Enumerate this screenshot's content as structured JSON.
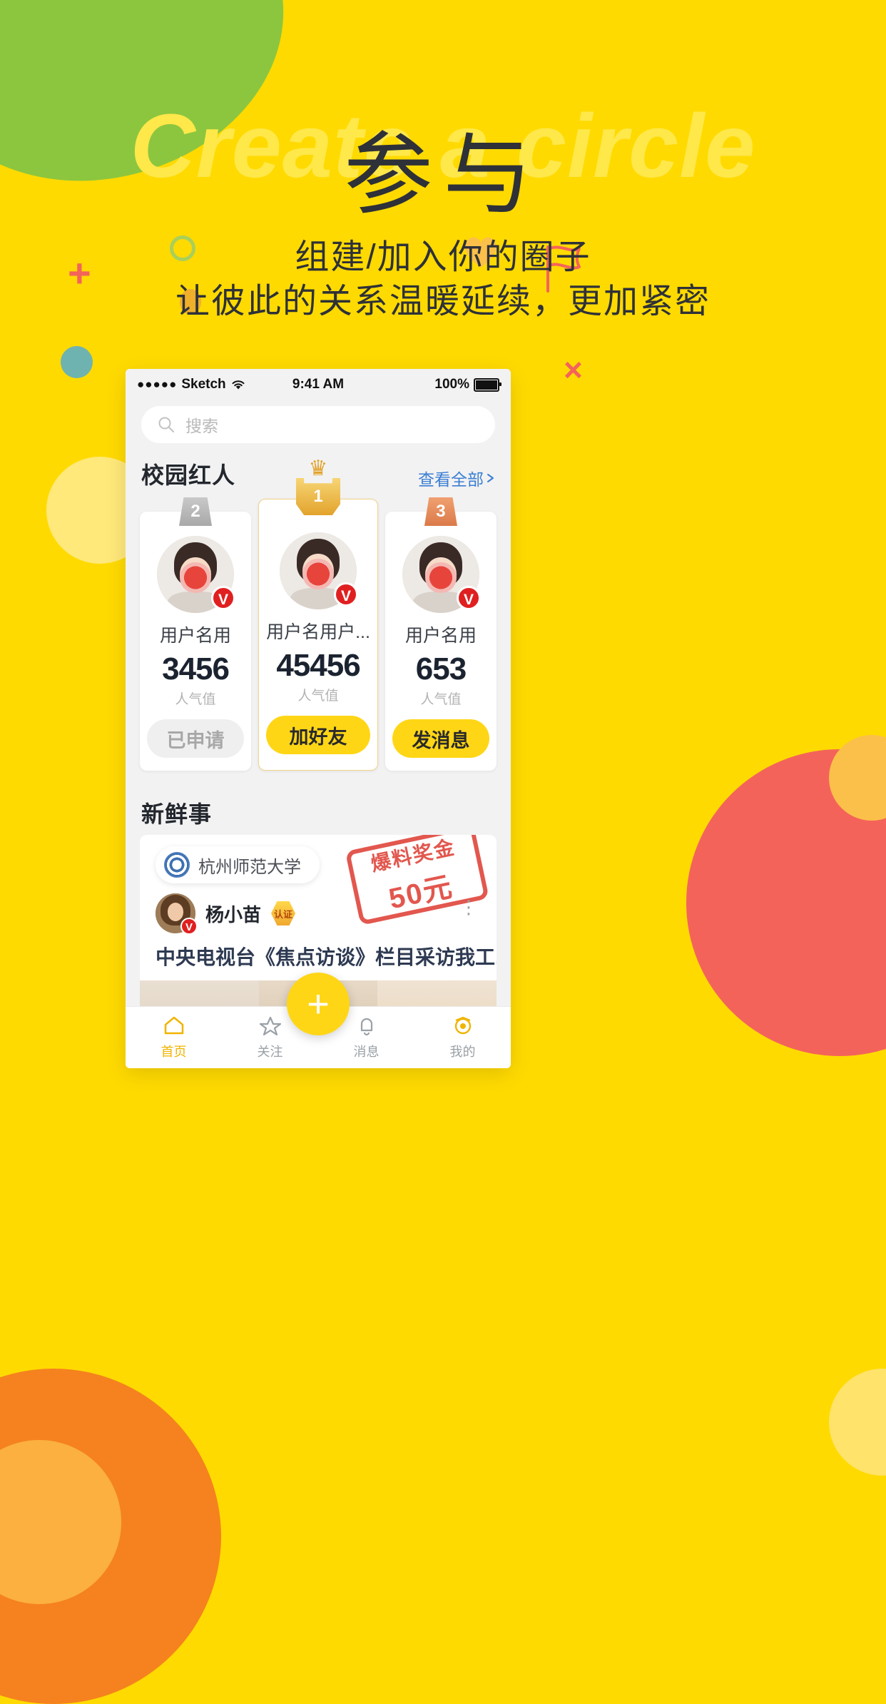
{
  "hero": {
    "ghost_word": "Create a circle",
    "title": "参与",
    "subtitle_line1": "组建/加入你的圈子",
    "subtitle_line2": "让彼此的关系温暖延续，更加紧密",
    "bg_color": "#FFDA00",
    "title_color": "#2E3138"
  },
  "phone": {
    "status_bar": {
      "signal_dots": "●●●●●",
      "carrier": "Sketch",
      "wifi_icon": "wifi-icon",
      "time": "9:41 AM",
      "battery_percent": "100%"
    },
    "search": {
      "placeholder": "搜索",
      "icon": "search-icon"
    },
    "ranking_section": {
      "title": "校园红人",
      "more_label": "查看全部",
      "more_color": "#3B7FD4",
      "cards": [
        {
          "rank": "2",
          "rank_color": "#A8A8A8",
          "name": "用户名用",
          "value": "3456",
          "value_label": "人气值",
          "action_label": "已申请",
          "action_state": "disabled",
          "verified": "V"
        },
        {
          "rank": "1",
          "rank_color": "#E2A32C",
          "name": "用户名用户...",
          "value": "45456",
          "value_label": "人气值",
          "action_label": "加好友",
          "action_state": "primary",
          "verified": "V",
          "crown": "crown-icon"
        },
        {
          "rank": "3",
          "rank_color": "#DB7A4A",
          "name": "用户名用",
          "value": "653",
          "value_label": "人气值",
          "action_label": "发消息",
          "action_state": "primary",
          "verified": "V"
        }
      ]
    },
    "feed_section": {
      "title": "新鲜事",
      "post": {
        "school": "杭州师范大学",
        "stamp_line1": "爆料奖金",
        "stamp_line2": "50元",
        "author": "杨小苗",
        "medal": "认证",
        "verified": "V",
        "title": "中央电视台《焦点访谈》栏目采访我工...",
        "more_icon": "more-vertical-icon"
      }
    },
    "tabbar": {
      "fab_label": "+",
      "items": [
        {
          "icon": "home-icon",
          "label": "首页",
          "active": true
        },
        {
          "icon": "star-icon",
          "label": "关注",
          "active": false
        },
        {
          "icon": "bell-icon",
          "label": "消息",
          "active": false
        },
        {
          "icon": "profile-icon",
          "label": "我的",
          "active": false
        }
      ]
    },
    "accent_color": "#FFD616"
  }
}
